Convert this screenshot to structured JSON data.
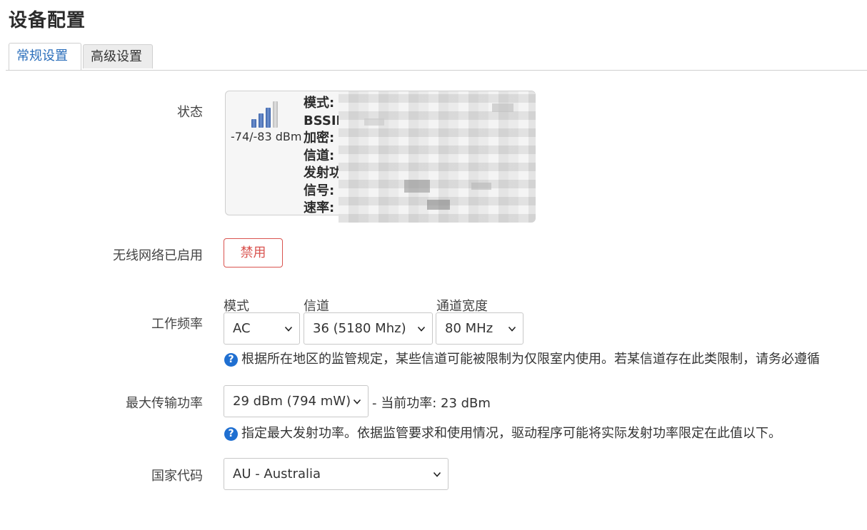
{
  "page": {
    "title": "设备配置"
  },
  "tabs": [
    {
      "label": "常规设置",
      "active": true
    },
    {
      "label": "高级设置",
      "active": false
    }
  ],
  "status": {
    "label": "状态",
    "signal_icon": "signal-strength-icon",
    "signal_text": "-74/-83 dBm",
    "fields": [
      "模式:",
      "BSSID:",
      "加密:",
      "信道:",
      "发射功率:",
      "信号:",
      "速率:"
    ]
  },
  "wireless": {
    "label": "无线网络已启用",
    "disable_button": "禁用",
    "disable_color": "#d9534f"
  },
  "frequency": {
    "label": "工作频率",
    "mode": {
      "label": "模式",
      "value": "AC"
    },
    "channel": {
      "label": "信道",
      "value": "36 (5180 Mhz)"
    },
    "width": {
      "label": "通道宽度",
      "value": "80 MHz"
    },
    "help": "根据所在地区的监管规定，某些信道可能被限制为仅限室内使用。若某信道存在此类限制，请务必遵循"
  },
  "tx_power": {
    "label": "最大传输功率",
    "value": "29 dBm (794 mW)",
    "current": "- 当前功率: 23 dBm",
    "help": "指定最大发射功率。依据监管要求和使用情况，驱动程序可能将实际发射功率限定在此值以下。"
  },
  "country": {
    "label": "国家代码",
    "value": "AU - Australia"
  },
  "help_icon": "?",
  "colors": {
    "accent": "#2a6ebb",
    "help_icon": "#1f6fd1"
  }
}
